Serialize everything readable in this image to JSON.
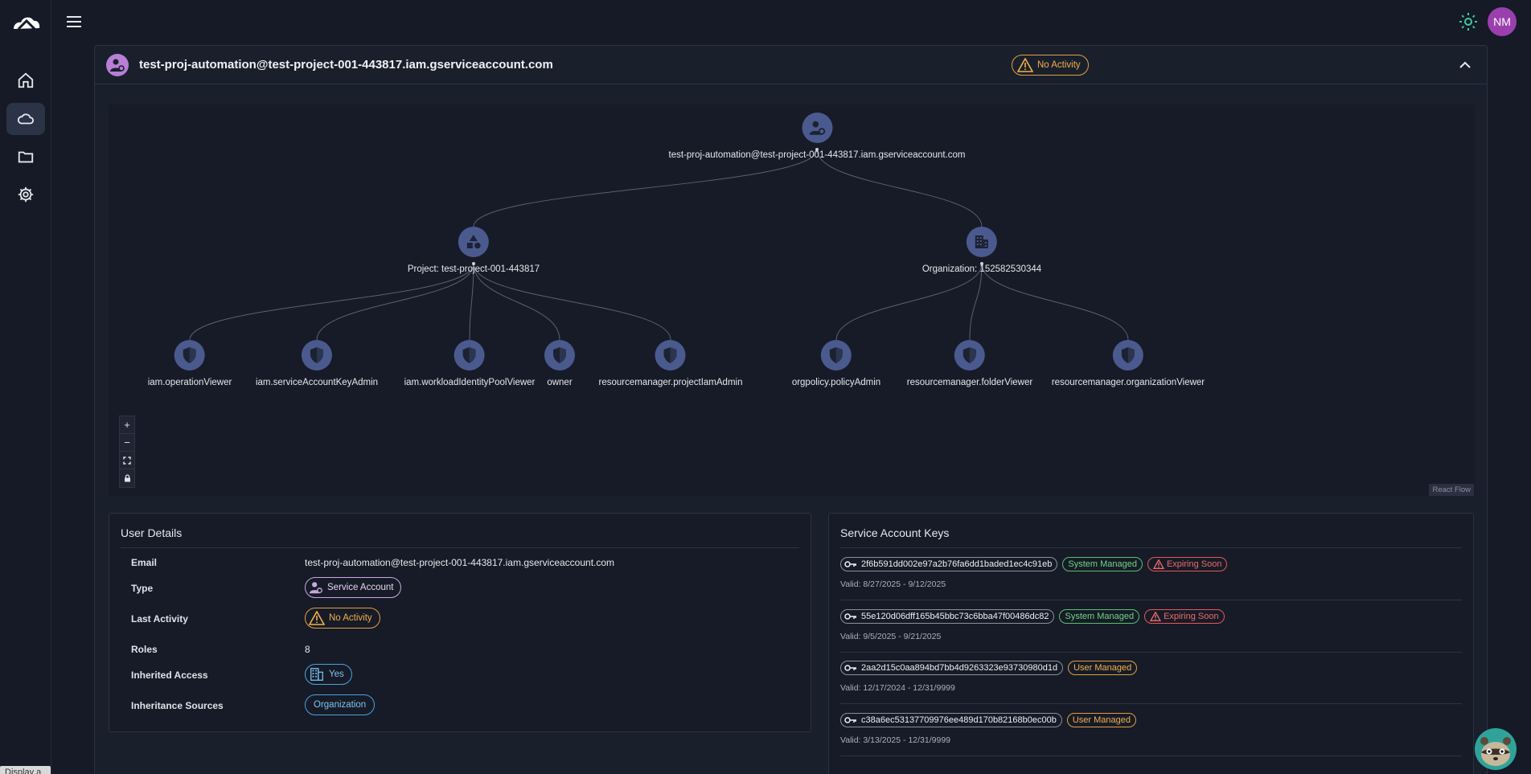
{
  "topbar": {
    "avatar_initials": "NM",
    "tooltip": "Display a menu"
  },
  "panel": {
    "title": "test-proj-automation@test-project-001-443817.iam.gserviceaccount.com",
    "status_badge": "No Activity"
  },
  "flow": {
    "root": {
      "label": "test-proj-automation@test-project-001-443817.iam.gserviceaccount.com",
      "icon": "service-account-icon"
    },
    "parents": [
      {
        "label": "Project: test-project-001-443817",
        "icon": "shapes-icon"
      },
      {
        "label": "Organization: 152582530344",
        "icon": "building-icon"
      }
    ],
    "roles": [
      {
        "label": "iam.operationViewer",
        "parent": 0
      },
      {
        "label": "iam.serviceAccountKeyAdmin",
        "parent": 0
      },
      {
        "label": "iam.workloadIdentityPoolViewer",
        "parent": 0
      },
      {
        "label": "owner",
        "parent": 0
      },
      {
        "label": "resourcemanager.projectIamAdmin",
        "parent": 0
      },
      {
        "label": "orgpolicy.policyAdmin",
        "parent": 1
      },
      {
        "label": "resourcemanager.folderViewer",
        "parent": 1
      },
      {
        "label": "resourcemanager.organizationViewer",
        "parent": 1
      }
    ],
    "controls": {
      "zoom_in": "+",
      "zoom_out": "−",
      "fit": "⛶",
      "lock": "🔒"
    },
    "attribution": "React Flow"
  },
  "user_details": {
    "title": "User Details",
    "rows": {
      "email": {
        "label": "Email",
        "value": "test-proj-automation@test-project-001-443817.iam.gserviceaccount.com"
      },
      "type": {
        "label": "Type",
        "value": "Service Account"
      },
      "last_activity": {
        "label": "Last Activity",
        "value": "No Activity"
      },
      "roles": {
        "label": "Roles",
        "value": "8"
      },
      "inherited_access": {
        "label": "Inherited Access",
        "value": "Yes"
      },
      "inheritance_sources": {
        "label": "Inheritance Sources",
        "value": "Organization"
      }
    }
  },
  "service_account_keys": {
    "title": "Service Account Keys",
    "keys": [
      {
        "id": "2f6b591dd002e97a2b76fa6dd1baded1ec4c91eb",
        "managed": "System Managed",
        "warning": "Expiring Soon",
        "valid": "Valid: 8/27/2025 - 9/12/2025"
      },
      {
        "id": "55e120d06dff165b45bbc73c6bba47f00486dc82",
        "managed": "System Managed",
        "warning": "Expiring Soon",
        "valid": "Valid: 9/5/2025 - 9/21/2025"
      },
      {
        "id": "2aa2d15c0aa894bd7bb4d9263323e93730980d1d",
        "managed": "User Managed",
        "warning": "",
        "valid": "Valid: 12/17/2024 - 12/31/9999"
      },
      {
        "id": "c38a6ec53137709976ee489d170b82168b0ec00b",
        "managed": "User Managed",
        "warning": "",
        "valid": "Valid: 3/13/2025 - 12/31/9999"
      }
    ]
  },
  "colors": {
    "accent_node": "#4b5a8e",
    "warning": "#f2b04a",
    "success": "#6fd682",
    "danger": "#f06a6a",
    "info": "#7cc4f2"
  }
}
